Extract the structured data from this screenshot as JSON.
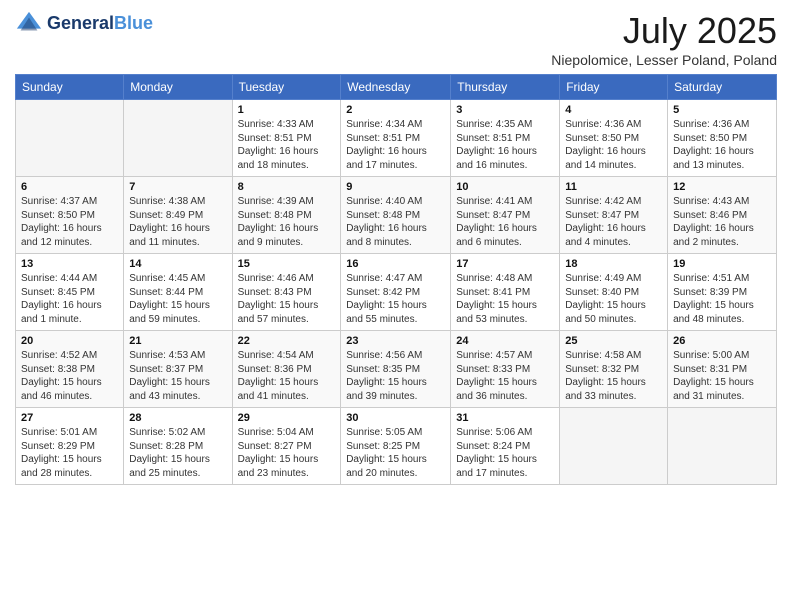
{
  "header": {
    "logo_line1": "General",
    "logo_line2": "Blue",
    "month": "July 2025",
    "location": "Niepolomice, Lesser Poland, Poland"
  },
  "weekdays": [
    "Sunday",
    "Monday",
    "Tuesday",
    "Wednesday",
    "Thursday",
    "Friday",
    "Saturday"
  ],
  "weeks": [
    [
      {
        "day": "",
        "info": ""
      },
      {
        "day": "",
        "info": ""
      },
      {
        "day": "1",
        "info": "Sunrise: 4:33 AM\nSunset: 8:51 PM\nDaylight: 16 hours and 18 minutes."
      },
      {
        "day": "2",
        "info": "Sunrise: 4:34 AM\nSunset: 8:51 PM\nDaylight: 16 hours and 17 minutes."
      },
      {
        "day": "3",
        "info": "Sunrise: 4:35 AM\nSunset: 8:51 PM\nDaylight: 16 hours and 16 minutes."
      },
      {
        "day": "4",
        "info": "Sunrise: 4:36 AM\nSunset: 8:50 PM\nDaylight: 16 hours and 14 minutes."
      },
      {
        "day": "5",
        "info": "Sunrise: 4:36 AM\nSunset: 8:50 PM\nDaylight: 16 hours and 13 minutes."
      }
    ],
    [
      {
        "day": "6",
        "info": "Sunrise: 4:37 AM\nSunset: 8:50 PM\nDaylight: 16 hours and 12 minutes."
      },
      {
        "day": "7",
        "info": "Sunrise: 4:38 AM\nSunset: 8:49 PM\nDaylight: 16 hours and 11 minutes."
      },
      {
        "day": "8",
        "info": "Sunrise: 4:39 AM\nSunset: 8:48 PM\nDaylight: 16 hours and 9 minutes."
      },
      {
        "day": "9",
        "info": "Sunrise: 4:40 AM\nSunset: 8:48 PM\nDaylight: 16 hours and 8 minutes."
      },
      {
        "day": "10",
        "info": "Sunrise: 4:41 AM\nSunset: 8:47 PM\nDaylight: 16 hours and 6 minutes."
      },
      {
        "day": "11",
        "info": "Sunrise: 4:42 AM\nSunset: 8:47 PM\nDaylight: 16 hours and 4 minutes."
      },
      {
        "day": "12",
        "info": "Sunrise: 4:43 AM\nSunset: 8:46 PM\nDaylight: 16 hours and 2 minutes."
      }
    ],
    [
      {
        "day": "13",
        "info": "Sunrise: 4:44 AM\nSunset: 8:45 PM\nDaylight: 16 hours and 1 minute."
      },
      {
        "day": "14",
        "info": "Sunrise: 4:45 AM\nSunset: 8:44 PM\nDaylight: 15 hours and 59 minutes."
      },
      {
        "day": "15",
        "info": "Sunrise: 4:46 AM\nSunset: 8:43 PM\nDaylight: 15 hours and 57 minutes."
      },
      {
        "day": "16",
        "info": "Sunrise: 4:47 AM\nSunset: 8:42 PM\nDaylight: 15 hours and 55 minutes."
      },
      {
        "day": "17",
        "info": "Sunrise: 4:48 AM\nSunset: 8:41 PM\nDaylight: 15 hours and 53 minutes."
      },
      {
        "day": "18",
        "info": "Sunrise: 4:49 AM\nSunset: 8:40 PM\nDaylight: 15 hours and 50 minutes."
      },
      {
        "day": "19",
        "info": "Sunrise: 4:51 AM\nSunset: 8:39 PM\nDaylight: 15 hours and 48 minutes."
      }
    ],
    [
      {
        "day": "20",
        "info": "Sunrise: 4:52 AM\nSunset: 8:38 PM\nDaylight: 15 hours and 46 minutes."
      },
      {
        "day": "21",
        "info": "Sunrise: 4:53 AM\nSunset: 8:37 PM\nDaylight: 15 hours and 43 minutes."
      },
      {
        "day": "22",
        "info": "Sunrise: 4:54 AM\nSunset: 8:36 PM\nDaylight: 15 hours and 41 minutes."
      },
      {
        "day": "23",
        "info": "Sunrise: 4:56 AM\nSunset: 8:35 PM\nDaylight: 15 hours and 39 minutes."
      },
      {
        "day": "24",
        "info": "Sunrise: 4:57 AM\nSunset: 8:33 PM\nDaylight: 15 hours and 36 minutes."
      },
      {
        "day": "25",
        "info": "Sunrise: 4:58 AM\nSunset: 8:32 PM\nDaylight: 15 hours and 33 minutes."
      },
      {
        "day": "26",
        "info": "Sunrise: 5:00 AM\nSunset: 8:31 PM\nDaylight: 15 hours and 31 minutes."
      }
    ],
    [
      {
        "day": "27",
        "info": "Sunrise: 5:01 AM\nSunset: 8:29 PM\nDaylight: 15 hours and 28 minutes."
      },
      {
        "day": "28",
        "info": "Sunrise: 5:02 AM\nSunset: 8:28 PM\nDaylight: 15 hours and 25 minutes."
      },
      {
        "day": "29",
        "info": "Sunrise: 5:04 AM\nSunset: 8:27 PM\nDaylight: 15 hours and 23 minutes."
      },
      {
        "day": "30",
        "info": "Sunrise: 5:05 AM\nSunset: 8:25 PM\nDaylight: 15 hours and 20 minutes."
      },
      {
        "day": "31",
        "info": "Sunrise: 5:06 AM\nSunset: 8:24 PM\nDaylight: 15 hours and 17 minutes."
      },
      {
        "day": "",
        "info": ""
      },
      {
        "day": "",
        "info": ""
      }
    ]
  ]
}
